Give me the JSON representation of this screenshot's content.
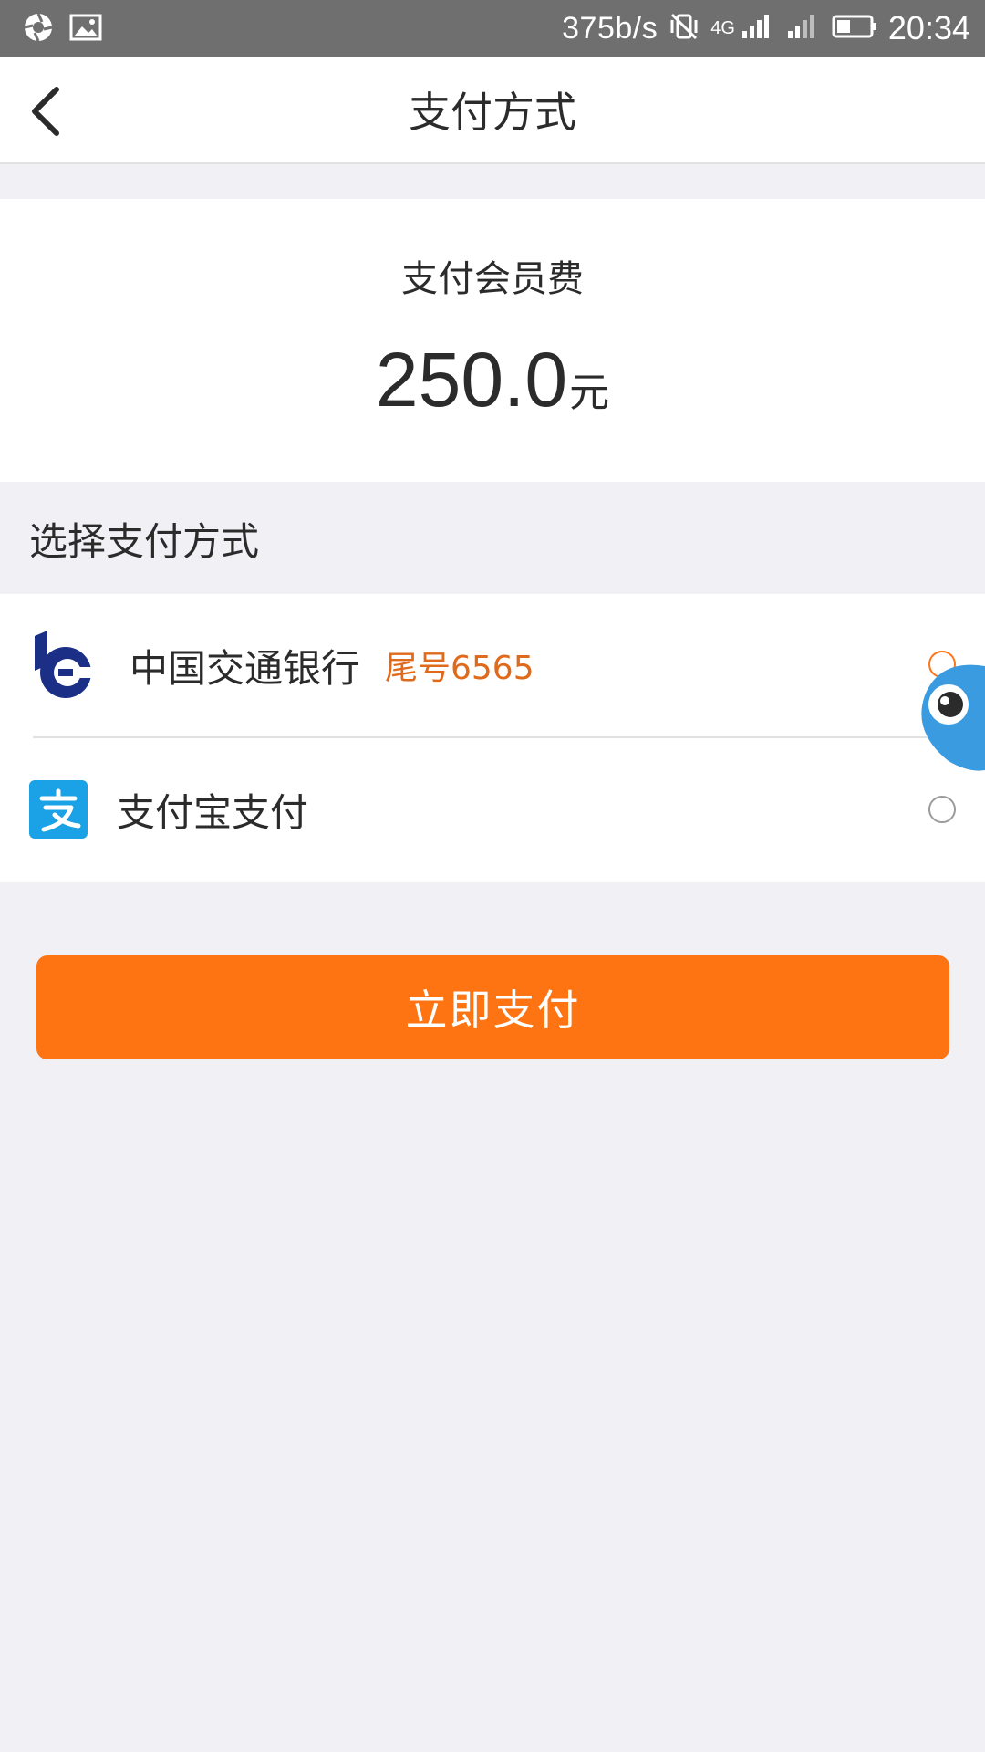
{
  "status_bar": {
    "speed": "375b/s",
    "network": "4G",
    "time": "20:34"
  },
  "header": {
    "title": "支付方式"
  },
  "amount": {
    "caption": "支付会员费",
    "value": "250.0",
    "unit": "元"
  },
  "section": {
    "label": "选择支付方式"
  },
  "methods": [
    {
      "name": "中国交通银行",
      "tail": "尾号6565",
      "selected": true,
      "icon": "bocom-logo-icon"
    },
    {
      "name": "支付宝支付",
      "selected": false,
      "icon": "alipay-logo-icon"
    }
  ],
  "pay_button": {
    "label": "立即支付"
  },
  "colors": {
    "accent": "#ff7412",
    "tail_text": "#e06a1b",
    "status_bar": "#6f6f6f",
    "page_bg": "#f0f0f5"
  }
}
